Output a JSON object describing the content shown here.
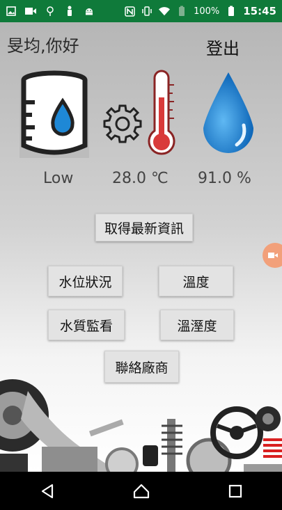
{
  "status_bar": {
    "battery_percent": "100%",
    "time": "15:45",
    "icons": [
      "image-icon",
      "video-icon",
      "location-icon",
      "person-icon",
      "android-icon",
      "nfc-icon",
      "vibrate-icon",
      "wifi-icon",
      "battery-saver-icon",
      "battery-icon"
    ]
  },
  "header": {
    "greeting": "旻均,你好",
    "logout_label": "登出"
  },
  "readings": {
    "water_level": "Low",
    "temperature": "28.0 ℃",
    "humidity": "91.0 %"
  },
  "buttons": {
    "refresh": "取得最新資訊",
    "water_level": "水位狀況",
    "temperature": "溫度",
    "water_quality": "水質監看",
    "humidity": "溫溼度",
    "contact": "聯絡廠商"
  },
  "colors": {
    "status_bar": "#0f7a3a",
    "drop_blue": "#1e88d6",
    "thermo_red": "#d93a3a"
  },
  "nav": {
    "icons": [
      "back-icon",
      "home-icon",
      "recents-icon"
    ]
  }
}
